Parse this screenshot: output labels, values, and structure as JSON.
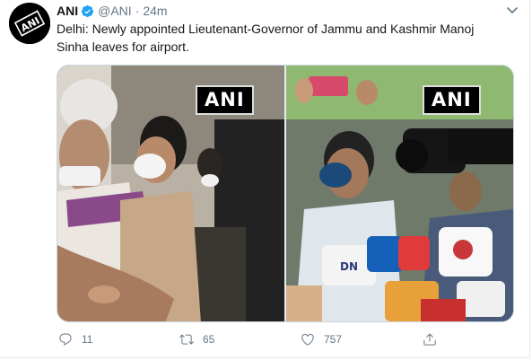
{
  "tweet": {
    "author_name": "ANI",
    "author_handle": "@ANI",
    "separator": "·",
    "time": "24m",
    "text": "Delhi: Newly appointed Lieutenant-Governor of Jammu and Kashmir Manoj\nSinha leaves for airport.",
    "avatar_text": "ANI",
    "media": [
      {
        "badge": "ANI"
      },
      {
        "badge": "ANI"
      }
    ],
    "actions": {
      "reply_count": "11",
      "retweet_count": "65",
      "like_count": "757"
    }
  },
  "colors": {
    "text_primary": "#14171a",
    "text_secondary": "#657786",
    "verified": "#1da1f2",
    "border": "#e6ecf0"
  },
  "icons": {
    "verified": "verified-badge-icon",
    "caret": "chevron-down-icon",
    "reply": "reply-icon",
    "retweet": "retweet-icon",
    "like": "heart-icon",
    "share": "share-icon"
  }
}
